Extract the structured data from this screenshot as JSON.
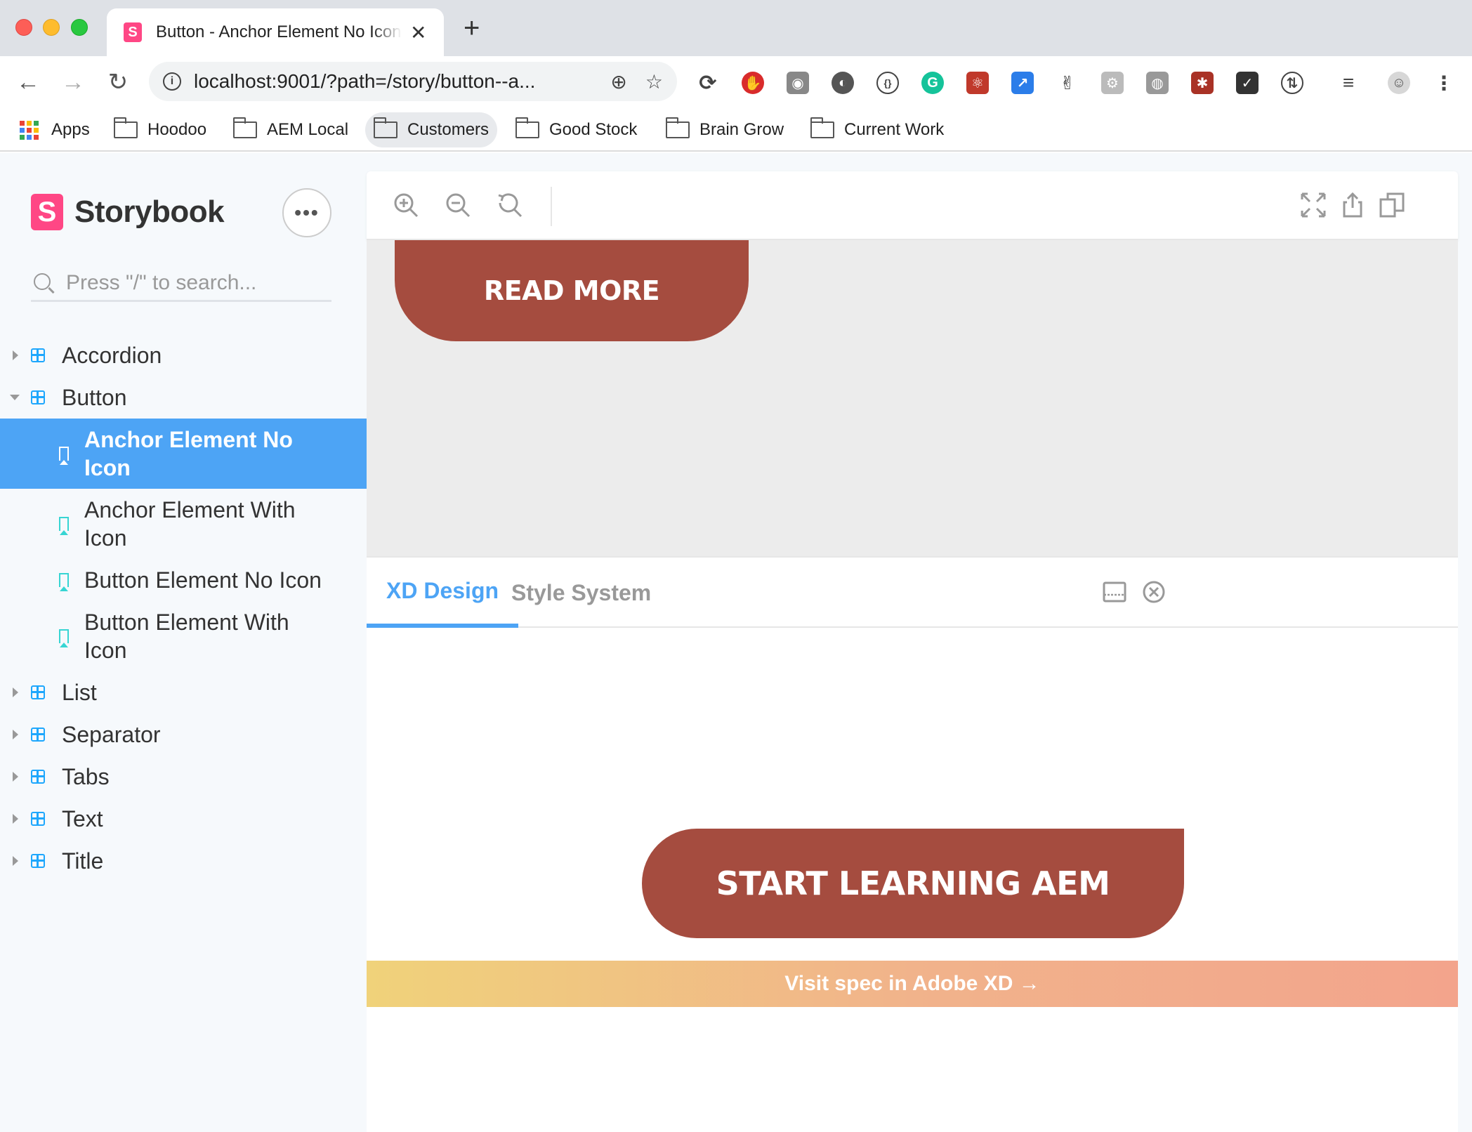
{
  "browser": {
    "tab_title": "Button - Anchor Element No Icon",
    "tab_favicon": "S",
    "new_tab_symbol": "+",
    "url_host": "localhost",
    "url_rest": ":9001/?path=/story/button--a...",
    "bookmarks": [
      {
        "label": "Apps"
      },
      {
        "label": "Hoodoo"
      },
      {
        "label": "AEM Local"
      },
      {
        "label": "Customers"
      },
      {
        "label": "Good Stock"
      },
      {
        "label": "Brain Grow"
      },
      {
        "label": "Current Work"
      }
    ]
  },
  "storybook": {
    "logo_mark": "S",
    "brand": "Storybook",
    "menu_dots": "•••",
    "search_placeholder": "Press \"/\" to search...",
    "tree": {
      "accordion": "Accordion",
      "button": "Button",
      "stories": [
        "Anchor Element No Icon",
        "Anchor Element With Icon",
        "Button Element No Icon",
        "Button Element With Icon"
      ],
      "list": "List",
      "separator": "Separator",
      "tabs": "Tabs",
      "text": "Text",
      "title": "Title"
    },
    "preview_button": "READ MORE",
    "addon_tabs": [
      "XD Design",
      "Style System"
    ],
    "xd_button": "START LEARNING AEM",
    "xd_footer": "Visit spec in Adobe XD →"
  },
  "colors": {
    "storybook_pink": "#ff4785",
    "selected_blue": "#4da4f5",
    "button_brown": "#a54c3f",
    "component_blue": "#1ea7fd",
    "story_teal": "#37d5d3"
  }
}
